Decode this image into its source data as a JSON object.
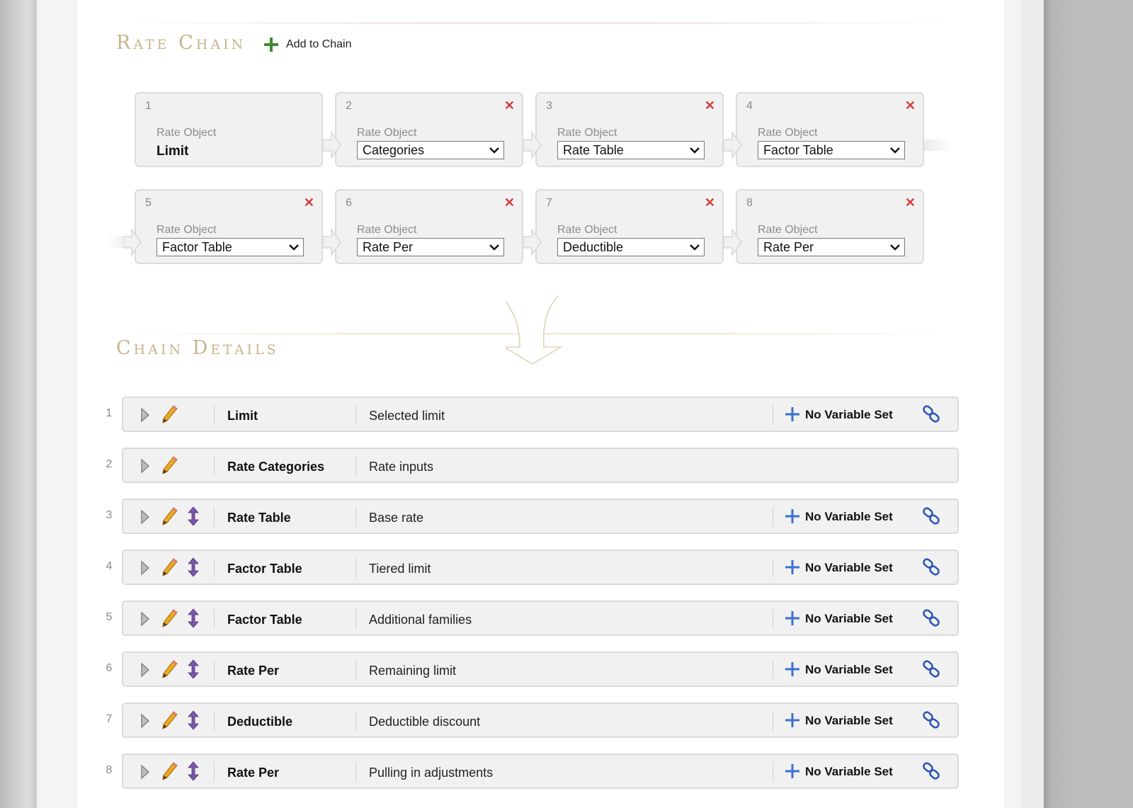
{
  "rate_chain": {
    "title": "Rate Chain",
    "add_label": "Add to Chain",
    "items": [
      {
        "num": "1",
        "label": "Rate Object",
        "value": "Limit",
        "editable": false,
        "removable": false
      },
      {
        "num": "2",
        "label": "Rate Object",
        "value": "Categories",
        "editable": true,
        "removable": true
      },
      {
        "num": "3",
        "label": "Rate Object",
        "value": "Rate Table",
        "editable": true,
        "removable": true
      },
      {
        "num": "4",
        "label": "Rate Object",
        "value": "Factor Table",
        "editable": true,
        "removable": true
      },
      {
        "num": "5",
        "label": "Rate Object",
        "value": "Factor Table",
        "editable": true,
        "removable": true
      },
      {
        "num": "6",
        "label": "Rate Object",
        "value": "Rate Per",
        "editable": true,
        "removable": true
      },
      {
        "num": "7",
        "label": "Rate Object",
        "value": "Deductible",
        "editable": true,
        "removable": true
      },
      {
        "num": "8",
        "label": "Rate Object",
        "value": "Rate Per",
        "editable": true,
        "removable": true
      }
    ]
  },
  "chain_details": {
    "title": "Chain Details",
    "rows": [
      {
        "num": "1",
        "name": "Limit",
        "desc": "Selected limit",
        "variable": "No Variable Set",
        "reorder": false,
        "has_variable": true
      },
      {
        "num": "2",
        "name": "Rate Categories",
        "desc": "Rate inputs",
        "variable": "",
        "reorder": false,
        "has_variable": false
      },
      {
        "num": "3",
        "name": "Rate Table",
        "desc": "Base rate",
        "variable": "No Variable Set",
        "reorder": true,
        "has_variable": true
      },
      {
        "num": "4",
        "name": "Factor Table",
        "desc": "Tiered limit",
        "variable": "No Variable Set",
        "reorder": true,
        "has_variable": true
      },
      {
        "num": "5",
        "name": "Factor Table",
        "desc": "Additional families",
        "variable": "No Variable Set",
        "reorder": true,
        "has_variable": true
      },
      {
        "num": "6",
        "name": "Rate Per",
        "desc": "Remaining limit",
        "variable": "No Variable Set",
        "reorder": true,
        "has_variable": true
      },
      {
        "num": "7",
        "name": "Deductible",
        "desc": "Deductible discount",
        "variable": "No Variable Set",
        "reorder": true,
        "has_variable": true
      },
      {
        "num": "8",
        "name": "Rate Per",
        "desc": "Pulling in adjustments",
        "variable": "No Variable Set",
        "reorder": true,
        "has_variable": true
      }
    ]
  },
  "colors": {
    "section_title": "#c7b48b",
    "remove_x": "#d23b3b",
    "add_plus": "#3d8a2e",
    "variable_plus": "#3b6fd1",
    "reorder": "#7b56a8",
    "pencil": "#e6a321"
  },
  "icons": {
    "add": "plus-icon",
    "remove": "close-icon",
    "expand": "triangle-right-icon",
    "edit": "pencil-icon",
    "reorder": "up-down-arrow-icon",
    "variable": "plus-icon",
    "link": "chain-link-icon",
    "dropdown": "chevron-down-icon"
  }
}
